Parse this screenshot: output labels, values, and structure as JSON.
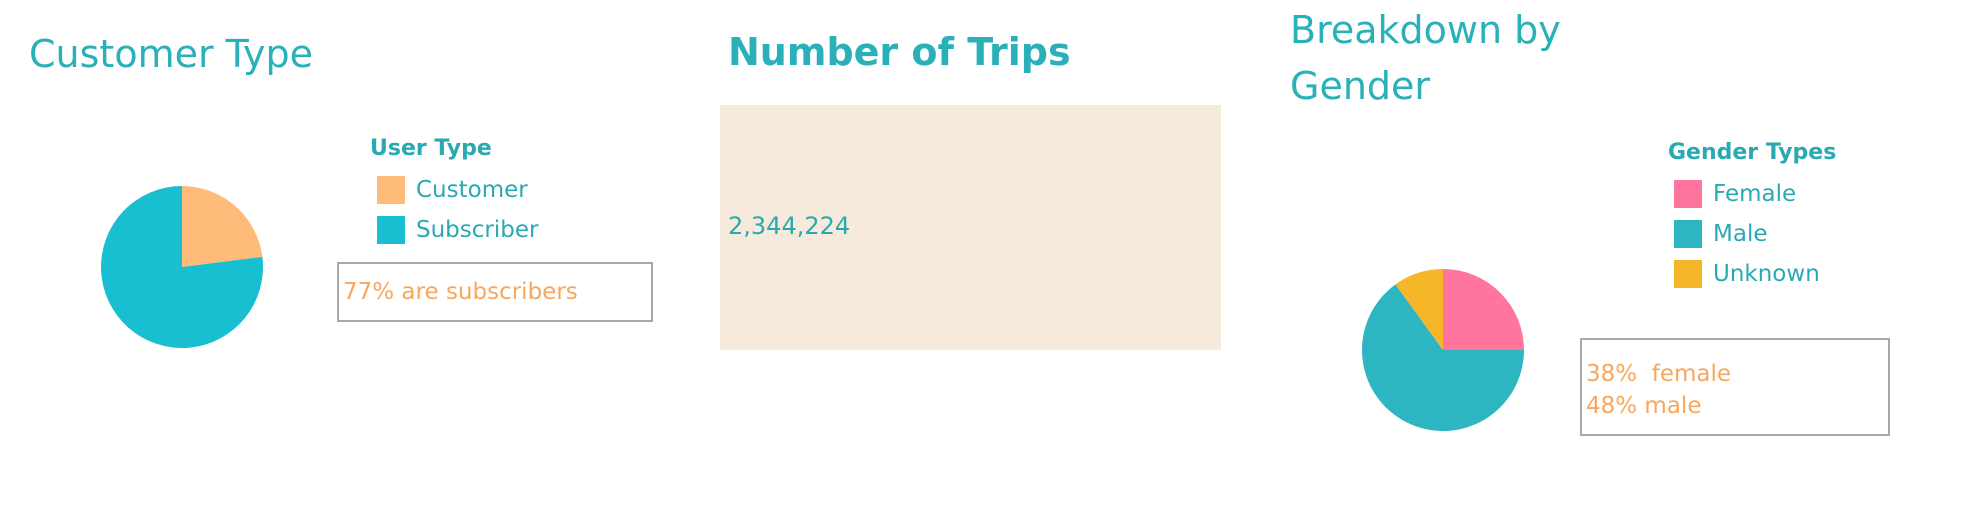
{
  "chart_data": [
    {
      "type": "pie",
      "title": "Customer Type",
      "legend_title": "User Type",
      "categories": [
        "Customer",
        "Subscriber"
      ],
      "values": [
        23,
        77
      ],
      "colors": [
        "#ffbb7a",
        "#18bfd0"
      ],
      "legend_position": "right",
      "annotation": "77% are subscribers"
    },
    {
      "type": "table",
      "title": "Number of Trips",
      "values": [
        2344224
      ],
      "value_label": "2,344,224",
      "background": "#f5eadb"
    },
    {
      "type": "pie",
      "title": "Breakdown by Gender",
      "title_lines": [
        "Breakdown by",
        "Gender"
      ],
      "legend_title": "Gender Types",
      "categories": [
        "Female",
        "Male",
        "Unknown"
      ],
      "values": [
        25,
        65,
        10
      ],
      "colors": [
        "#ff759d",
        "#2db5c2",
        "#f6b62a"
      ],
      "legend_position": "right",
      "annotation_lines": [
        "38%  female",
        "48% male"
      ]
    }
  ]
}
